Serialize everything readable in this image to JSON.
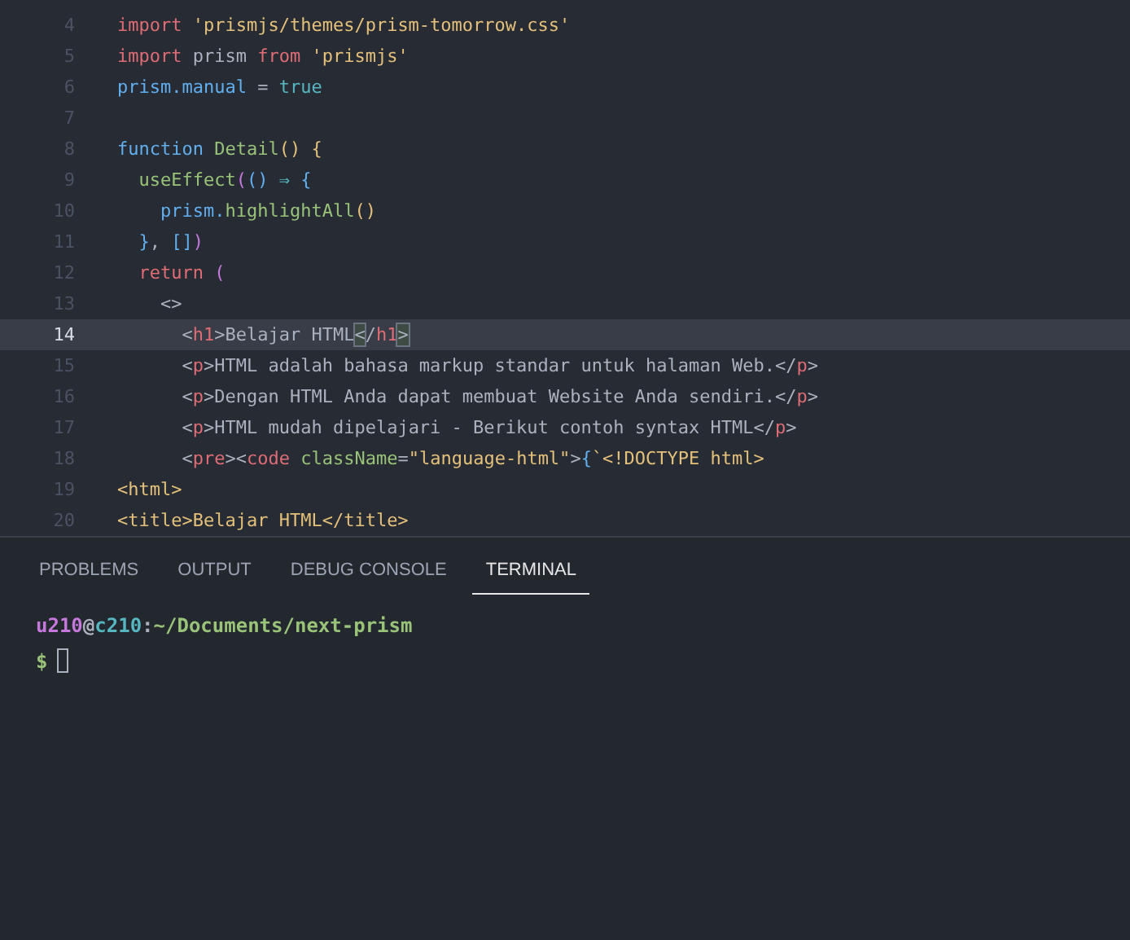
{
  "editor": {
    "lines": [
      {
        "number": "4",
        "selected": false,
        "tokens": [
          {
            "kind": "keyword",
            "text": "import "
          },
          {
            "kind": "string",
            "text": "'prismjs/themes/prism-tomorrow.css'"
          }
        ]
      },
      {
        "number": "5",
        "selected": false,
        "tokens": [
          {
            "kind": "keyword",
            "text": "import "
          },
          {
            "kind": "plain",
            "text": "prism "
          },
          {
            "kind": "keyword",
            "text": "from "
          },
          {
            "kind": "string",
            "text": "'prismjs'"
          }
        ]
      },
      {
        "number": "6",
        "selected": false,
        "tokens": [
          {
            "kind": "variable",
            "text": "prism.manual"
          },
          {
            "kind": "plain",
            "text": " = "
          },
          {
            "kind": "constant",
            "text": "true"
          }
        ]
      },
      {
        "number": "7",
        "selected": false
      },
      {
        "number": "8",
        "selected": false,
        "tokens": [
          {
            "kind": "variable",
            "text": "function "
          },
          {
            "kind": "function",
            "text": "Detail"
          },
          {
            "kind": "bracket",
            "text": "() {"
          }
        ]
      },
      {
        "number": "9",
        "selected": false,
        "tokens": [
          {
            "kind": "function",
            "text": "  useEffect"
          },
          {
            "kind": "bracket2",
            "text": "("
          },
          {
            "kind": "bracket3",
            "text": "() "
          },
          {
            "kind": "constant",
            "text": "⇒ "
          },
          {
            "kind": "bracket3",
            "text": "{"
          }
        ]
      },
      {
        "number": "10",
        "selected": false,
        "tokens": [
          {
            "kind": "variable",
            "text": "    prism."
          },
          {
            "kind": "function",
            "text": "highlightAll"
          },
          {
            "kind": "bracket",
            "text": "()"
          }
        ]
      },
      {
        "number": "11",
        "selected": false,
        "tokens": [
          {
            "kind": "bracket3",
            "text": "  }"
          },
          {
            "kind": "plain",
            "text": ", "
          },
          {
            "kind": "bracket3",
            "text": "[]"
          },
          {
            "kind": "bracket2",
            "text": ")"
          }
        ]
      },
      {
        "number": "12",
        "selected": false,
        "tokens": [
          {
            "kind": "keyword",
            "text": "  return "
          },
          {
            "kind": "bracket2",
            "text": "("
          }
        ]
      },
      {
        "number": "13",
        "selected": false,
        "tokens": [
          {
            "kind": "plain",
            "text": "    <>"
          }
        ]
      },
      {
        "number": "14",
        "selected": true,
        "tokens": [
          {
            "kind": "plain",
            "text": "      <"
          },
          {
            "kind": "keyword",
            "text": "h1"
          },
          {
            "kind": "plain",
            "text": ">Belajar HTML"
          },
          {
            "kind": "match",
            "text": "<"
          },
          {
            "kind": "plain",
            "text": "/"
          },
          {
            "kind": "keyword",
            "text": "h1"
          },
          {
            "kind": "match",
            "text": ">"
          }
        ]
      },
      {
        "number": "15",
        "selected": false,
        "tokens": [
          {
            "kind": "plain",
            "text": "      <"
          },
          {
            "kind": "keyword",
            "text": "p"
          },
          {
            "kind": "plain",
            "text": ">HTML adalah bahasa markup standar untuk halaman Web.</"
          },
          {
            "kind": "keyword",
            "text": "p"
          },
          {
            "kind": "plain",
            "text": ">"
          }
        ]
      },
      {
        "number": "16",
        "selected": false,
        "tokens": [
          {
            "kind": "plain",
            "text": "      <"
          },
          {
            "kind": "keyword",
            "text": "p"
          },
          {
            "kind": "plain",
            "text": ">Dengan HTML Anda dapat membuat Website Anda sendiri.</"
          },
          {
            "kind": "keyword",
            "text": "p"
          },
          {
            "kind": "plain",
            "text": ">"
          }
        ]
      },
      {
        "number": "17",
        "selected": false,
        "tokens": [
          {
            "kind": "plain",
            "text": "      <"
          },
          {
            "kind": "keyword",
            "text": "p"
          },
          {
            "kind": "plain",
            "text": ">HTML mudah dipelajari - Berikut contoh syntax HTML</"
          },
          {
            "kind": "keyword",
            "text": "p"
          },
          {
            "kind": "plain",
            "text": ">"
          }
        ]
      },
      {
        "number": "18",
        "selected": false,
        "tokens": [
          {
            "kind": "plain",
            "text": "      <"
          },
          {
            "kind": "keyword",
            "text": "pre"
          },
          {
            "kind": "plain",
            "text": "><"
          },
          {
            "kind": "keyword",
            "text": "code "
          },
          {
            "kind": "function",
            "text": "className"
          },
          {
            "kind": "plain",
            "text": "="
          },
          {
            "kind": "string",
            "text": "\"language-html\""
          },
          {
            "kind": "plain",
            "text": ">"
          },
          {
            "kind": "variable",
            "text": "{"
          },
          {
            "kind": "string",
            "text": "`<!DOCTYPE html>"
          }
        ]
      },
      {
        "number": "19",
        "selected": false,
        "tokens": [
          {
            "kind": "string",
            "text": "<html>"
          }
        ]
      },
      {
        "number": "20",
        "selected": false,
        "tokens": [
          {
            "kind": "string",
            "text": "<title>Belajar HTML</title>"
          }
        ]
      }
    ]
  },
  "panel": {
    "tabs": [
      {
        "label": "PROBLEMS",
        "selected": false
      },
      {
        "label": "OUTPUT",
        "selected": false
      },
      {
        "label": "DEBUG CONSOLE",
        "selected": false
      },
      {
        "label": "TERMINAL",
        "selected": true
      }
    ],
    "terminal": {
      "prompt": [
        {
          "kind": "user",
          "text": "u210"
        },
        {
          "kind": "plain",
          "text": "@"
        },
        {
          "kind": "host",
          "text": "c210"
        },
        {
          "kind": "plain",
          "text": ":"
        },
        {
          "kind": "path",
          "text": "~/Documents/next-prism"
        }
      ],
      "input_prompt": "$"
    }
  }
}
